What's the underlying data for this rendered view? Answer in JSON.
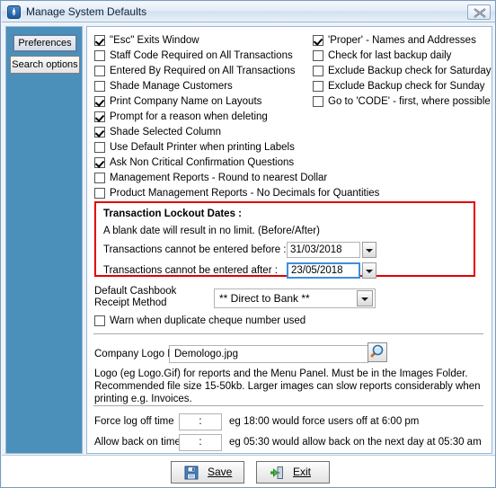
{
  "window": {
    "title": "Manage System Defaults",
    "icon": "power-icon",
    "close_label": "Close"
  },
  "sidebar": {
    "tabs": [
      {
        "label": "Preferences",
        "selected": true
      },
      {
        "label": "Search options",
        "selected": false
      }
    ]
  },
  "checkboxes": {
    "left_column": [
      {
        "label": "\"Esc\" Exits Window",
        "checked": true
      },
      {
        "label": "Staff Code Required on All Transactions",
        "checked": false
      },
      {
        "label": "Entered By Required on All Transactions",
        "checked": false
      },
      {
        "label": "Shade Manage Customers",
        "checked": false
      },
      {
        "label": "Print Company Name on Layouts",
        "checked": true
      },
      {
        "label": "Prompt for a reason when deleting",
        "checked": true
      },
      {
        "label": "Shade Selected Column",
        "checked": true
      },
      {
        "label": "Use Default Printer when printing Labels",
        "checked": false
      },
      {
        "label": "Ask Non Critical Confirmation Questions",
        "checked": true
      },
      {
        "label": "Management Reports -  Round to nearest Dollar",
        "checked": false
      },
      {
        "label": "Product Management Reports - No Decimals for Quantities",
        "checked": false
      }
    ],
    "right_column": [
      {
        "label": "'Proper' - Names and Addresses",
        "checked": true
      },
      {
        "label": "Check for last backup daily",
        "checked": false
      },
      {
        "label": "Exclude Backup check for Saturday",
        "checked": false
      },
      {
        "label": "Exclude Backup check for Sunday",
        "checked": false
      },
      {
        "label": "Go to 'CODE' - first, where possible",
        "checked": false
      }
    ]
  },
  "lockout": {
    "title": "Transaction Lockout Dates :",
    "subtitle": "A blank date will result in no limit. (Before/After)",
    "before_label": "Transactions cannot be entered before :",
    "before_value": "31/03/2018",
    "after_label": "Transactions cannot be entered after :",
    "after_value": "23/05/2018",
    "border_color": "#e40000"
  },
  "cashbook": {
    "label": "Default Cashbook Receipt Method",
    "value": "** Direct to Bank **",
    "warn_label": "Warn when duplicate cheque number used",
    "warn_checked": false
  },
  "logo": {
    "label": "Company Logo File",
    "value": "Demologo.jpg",
    "browse_icon": "magnifier-icon",
    "description": "Logo (eg Logo.Gif) for reports and the Menu Panel. Must be in the Images Folder. Recommended file size 15-50kb. Larger images can slow reports considerably when printing e.g. Invoices."
  },
  "times": {
    "force_logoff_label": "Force log off time",
    "force_logoff_value": ":",
    "force_logoff_hint": "eg  18:00  would force users off at 6:00 pm",
    "allow_back_label": "Allow back on time",
    "allow_back_value": ":",
    "allow_back_hint": "eg  05:30  would allow back on the next day at 05:30 am"
  },
  "footer": {
    "save_label": "Save",
    "save_icon": "floppy-disk-icon",
    "exit_label": "Exit",
    "exit_icon": "exit-door-icon"
  }
}
